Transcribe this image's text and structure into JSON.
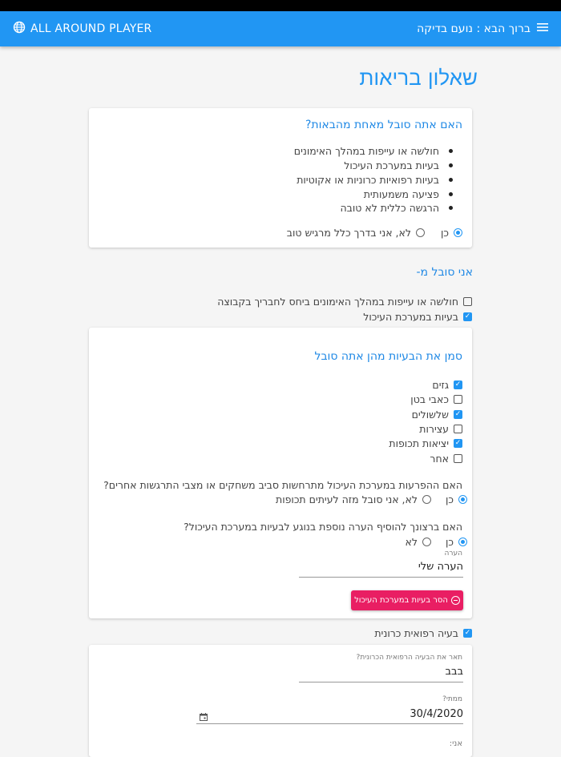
{
  "appbar": {
    "brand": "ALL AROUND PLAYER",
    "greeting": "ברוך הבא : נועם בדיקה"
  },
  "page_title": "שאלון בריאות",
  "card1": {
    "question": "האם אתה סובל מאחת מהבאות?",
    "items": [
      "חולשה או עייפות במהלך האימונים",
      "בעיות במערכת העיכול",
      "בעיות רפואיות כרוניות או אקוטיות",
      "פציעה משמעותית",
      "הרגשה כללית לא טובה"
    ],
    "option_yes": "כן",
    "option_no": "לא, אני בדרך כלל מרגיש טוב",
    "selected": "yes"
  },
  "suffer_section": {
    "title": "אני סובל מ-",
    "options": [
      {
        "label": "חולשה או עייפות במהלך האימונים ביחס לחבריך בקבוצה",
        "checked": false
      },
      {
        "label": "בעיות במערכת העיכול",
        "checked": true
      }
    ]
  },
  "digestive_card": {
    "title": "סמן את הבעיות מהן אתה סובל",
    "problems": [
      {
        "label": "גזים",
        "checked": true
      },
      {
        "label": "כאבי בטן",
        "checked": false
      },
      {
        "label": "שלשולים",
        "checked": true
      },
      {
        "label": "עצירות",
        "checked": false
      },
      {
        "label": "יציאות תכופות",
        "checked": true
      },
      {
        "label": "אחר",
        "checked": false
      }
    ],
    "q2": "האם ההפרעות במערכת העיכול מתרחשות סביב משחקים או מצבי התרגשות אחרים?",
    "q2_yes": "כן",
    "q2_no": "לא, אני סובל מזה לעיתים תכופות",
    "q3": "האם ברצונך להוסיף הערה נוספת בנוגע לבעיות במערכת העיכול?",
    "q3_yes": "כן",
    "q3_no": "לא",
    "note_label": "הערה",
    "note_value": "הערה שלי",
    "remove_button": "הסר בעיות במערכת העיכול"
  },
  "chronic": {
    "checkbox_label": "בעיה רפואית כרונית",
    "checked": true,
    "describe_label": "תאר את הבעיה הרפואית הכרונית?",
    "describe_value": "בבב",
    "since_label": "ממתי?",
    "since_value": "30/4/2020",
    "i_label": "אני:"
  }
}
